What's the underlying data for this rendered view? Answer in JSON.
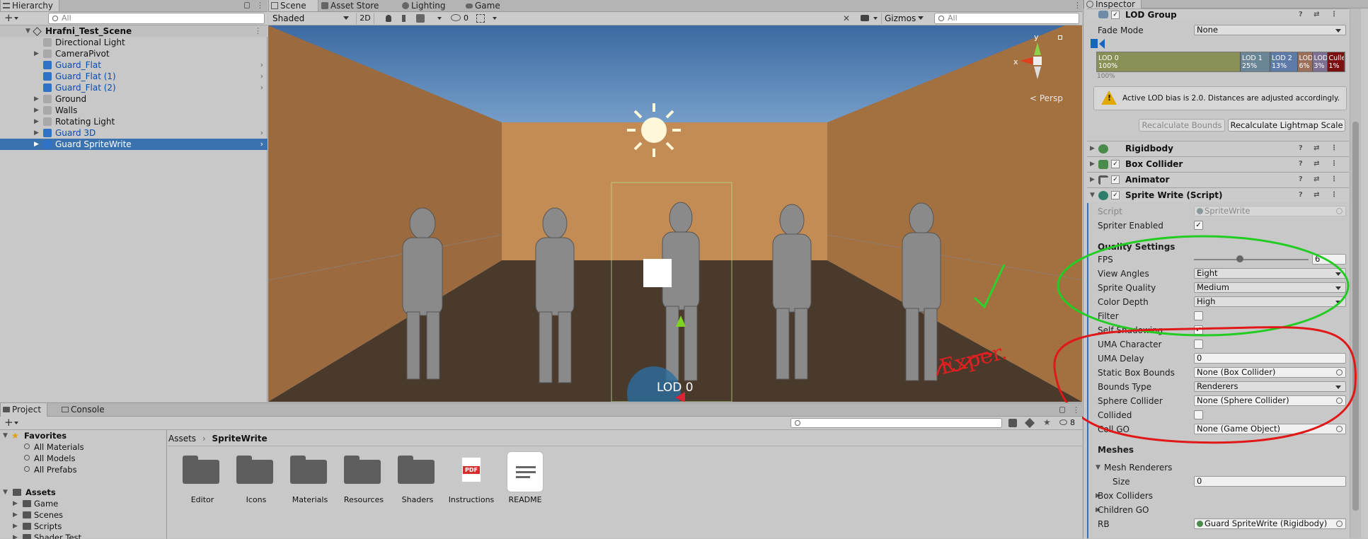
{
  "hierarchy": {
    "tab_title": "Hierarchy",
    "search_placeholder": "All",
    "scene_name": "Hrafni_Test_Scene",
    "items": [
      {
        "label": "Directional Light",
        "prefab": false,
        "expandable": false,
        "selected": false
      },
      {
        "label": "CameraPivot",
        "prefab": false,
        "expandable": true,
        "selected": false
      },
      {
        "label": "Guard_Flat",
        "prefab": true,
        "expandable": false,
        "selected": false
      },
      {
        "label": "Guard_Flat (1)",
        "prefab": true,
        "expandable": false,
        "selected": false
      },
      {
        "label": "Guard_Flat (2)",
        "prefab": true,
        "expandable": false,
        "selected": false
      },
      {
        "label": "Ground",
        "prefab": false,
        "expandable": true,
        "selected": false
      },
      {
        "label": "Walls",
        "prefab": false,
        "expandable": true,
        "selected": false
      },
      {
        "label": "Rotating Light",
        "prefab": false,
        "expandable": true,
        "selected": false
      },
      {
        "label": "Guard 3D",
        "prefab": true,
        "expandable": true,
        "selected": false
      },
      {
        "label": "Guard SpriteWrite",
        "prefab": true,
        "expandable": true,
        "selected": true
      }
    ]
  },
  "scene_tabs": [
    "Scene",
    "Asset Store",
    "Lighting",
    "Game"
  ],
  "scene_toolbar": {
    "shading": "Shaded",
    "mode_2d": "2D",
    "hidden_count": "0",
    "gizmos": "Gizmos",
    "search_placeholder": "All"
  },
  "viewport": {
    "persp_label": "< Persp",
    "lod_label": "LOD 0",
    "axis_x": "x",
    "axis_y": "y",
    "annotation_text": "Exper."
  },
  "inspector": {
    "tab_title": "Inspector",
    "lod_group": {
      "title": "LOD Group",
      "fade_mode_label": "Fade Mode",
      "fade_mode_value": "None",
      "lods": [
        {
          "name": "LOD 0",
          "pct": "100%",
          "color": "#8a8f55"
        },
        {
          "name": "LOD 1",
          "pct": "25%",
          "color": "#6a8696"
        },
        {
          "name": "LOD 2",
          "pct": "13%",
          "color": "#5e7aa6"
        },
        {
          "name": "LOD",
          "pct": "6%",
          "color": "#9c6f5a"
        },
        {
          "name": "LOD",
          "pct": "3%",
          "color": "#7c6f91"
        },
        {
          "name": "Culled",
          "pct": "1%",
          "color": "#7a1010"
        }
      ],
      "ruler_label": "100%",
      "warning": "Active LOD bias is 2.0. Distances are adjusted accordingly.",
      "btn_recalc_bounds": "Recalculate Bounds",
      "btn_recalc_lightmap": "Recalculate Lightmap Scale"
    },
    "components": [
      "Rigidbody",
      "Box Collider",
      "Animator",
      "Sprite Write (Script)"
    ],
    "sprite_write": {
      "script_label": "Script",
      "script_value": "SpriteWrite",
      "spriter_enabled_label": "Spriter Enabled",
      "quality_header": "Quality Settings",
      "fps_label": "FPS",
      "fps_value": "6",
      "fps_fraction": 0.4,
      "view_angles_label": "View Angles",
      "view_angles_value": "Eight",
      "sprite_quality_label": "Sprite Quality",
      "sprite_quality_value": "Medium",
      "color_depth_label": "Color Depth",
      "color_depth_value": "High",
      "filter_label": "Filter",
      "self_shadowing_label": "Self Shadowing",
      "uma_character_label": "UMA Character",
      "uma_delay_label": "UMA Delay",
      "uma_delay_value": "0",
      "static_box_bounds_label": "Static Box Bounds",
      "static_box_bounds_value": "None (Box Collider)",
      "bounds_type_label": "Bounds Type",
      "bounds_type_value": "Renderers",
      "sphere_collider_label": "Sphere Collider",
      "sphere_collider_value": "None (Sphere Collider)",
      "collided_label": "Collided",
      "coll_go_label": "Coll GO",
      "coll_go_value": "None (Game Object)",
      "meshes_header": "Meshes",
      "mesh_renderers_label": "Mesh Renderers",
      "size_label": "Size",
      "size_value": "0",
      "box_colliders_label": "Box Colliders",
      "children_go_label": "Children GO",
      "rb_label": "RB",
      "rb_value": "Guard SpriteWrite (Rigidbody)"
    }
  },
  "project": {
    "tabs": [
      "Project",
      "Console"
    ],
    "badge_count": "8",
    "favorites_label": "Favorites",
    "favorites": [
      "All Materials",
      "All Models",
      "All Prefabs"
    ],
    "assets_label": "Assets",
    "asset_tree": [
      "Game",
      "Scenes",
      "Scripts",
      "Shader Test"
    ],
    "breadcrumb": [
      "Assets",
      "SpriteWrite"
    ],
    "grid_items": [
      {
        "label": "Editor",
        "kind": "folder"
      },
      {
        "label": "Icons",
        "kind": "folder"
      },
      {
        "label": "Materials",
        "kind": "folder"
      },
      {
        "label": "Resources",
        "kind": "folder"
      },
      {
        "label": "Shaders",
        "kind": "folder"
      },
      {
        "label": "Instructions",
        "kind": "pdf"
      },
      {
        "label": "README",
        "kind": "doc"
      }
    ],
    "pdf_badge": "PDF"
  }
}
